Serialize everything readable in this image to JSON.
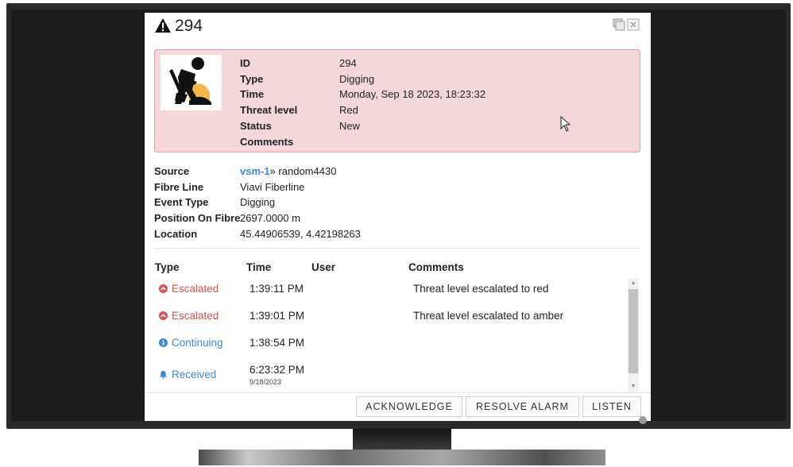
{
  "dialog": {
    "title": "294",
    "icons": {
      "warning": "warning-triangle-icon",
      "restore": "restore-window-icon",
      "close": "close-icon"
    }
  },
  "alarm": {
    "image": "digging-worker-icon",
    "colors": {
      "background": "#f3d7db",
      "border": "#e5a1aa"
    },
    "fields": [
      {
        "label": "ID",
        "value": "294"
      },
      {
        "label": "Type",
        "value": "Digging"
      },
      {
        "label": "Time",
        "value": "Monday, Sep 18 2023, 18:23:32"
      },
      {
        "label": "Threat level",
        "value": "Red"
      },
      {
        "label": "Status",
        "value": "New"
      },
      {
        "label": "Comments",
        "value": ""
      }
    ]
  },
  "details": {
    "source": {
      "label": "Source",
      "link": "vsm-1",
      "separator": "»",
      "value": " random4430"
    },
    "fibre_line": {
      "label": "Fibre Line",
      "value": "Viavi Fiberline"
    },
    "event_type": {
      "label": "Event Type",
      "value": "Digging"
    },
    "position": {
      "label": "Position On Fibre",
      "value": "2697.0000 m"
    },
    "location": {
      "label": "Location",
      "value": "45.44906539, 4.42198263"
    }
  },
  "log": {
    "headers": {
      "type": "Type",
      "time": "Time",
      "user": "User",
      "comments": "Comments"
    },
    "rows": [
      {
        "type": "Escalated",
        "icon": "chevron-up-circle-icon",
        "color": "#d9534f",
        "time": "1:39:11 PM",
        "date": "",
        "user": "",
        "comment": "Threat level escalated to red"
      },
      {
        "type": "Escalated",
        "icon": "chevron-up-circle-icon",
        "color": "#d9534f",
        "time": "1:39:01 PM",
        "date": "",
        "user": "",
        "comment": "Threat level escalated to amber"
      },
      {
        "type": "Continuing",
        "icon": "info-circle-icon",
        "color": "#3a8ad6",
        "time": "1:38:54 PM",
        "date": "",
        "user": "",
        "comment": ""
      },
      {
        "type": "Received",
        "icon": "bell-icon",
        "color": "#3a8ad6",
        "time": "6:23:32 PM",
        "date": "9/18/2023",
        "user": "",
        "comment": ""
      }
    ]
  },
  "actions": {
    "acknowledge": "ACKNOWLEDGE",
    "resolve": "RESOLVE ALARM",
    "listen": "LISTEN"
  }
}
